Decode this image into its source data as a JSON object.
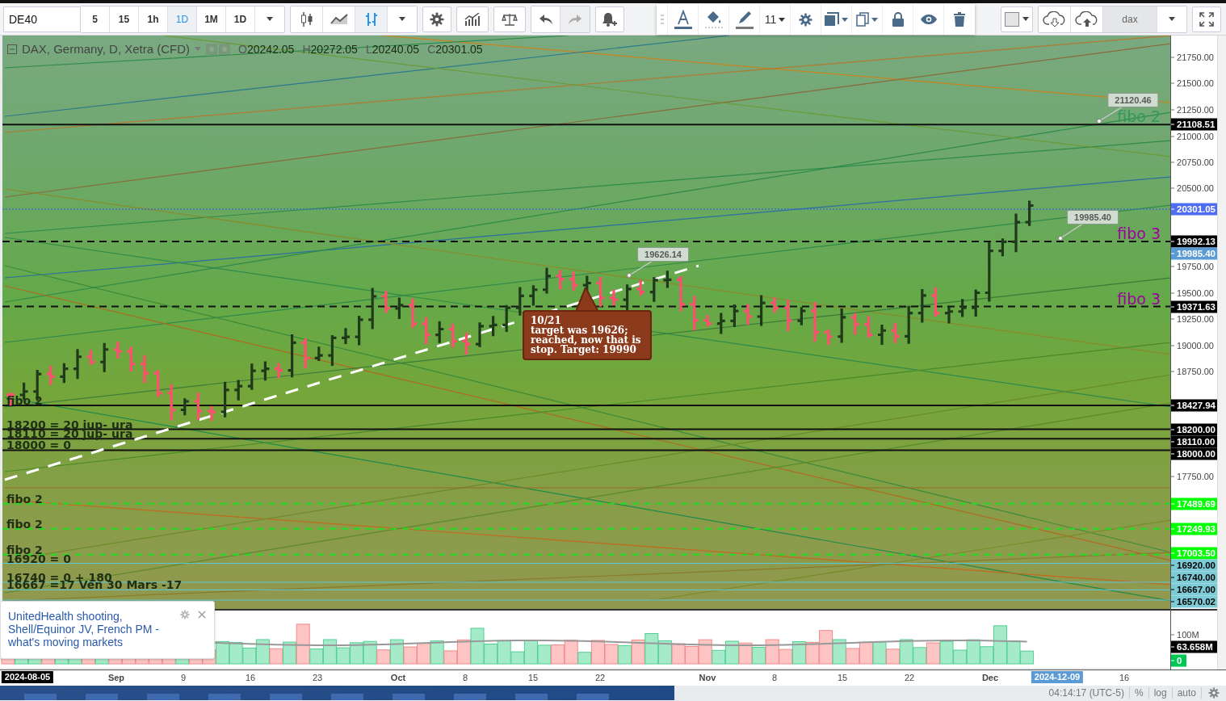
{
  "toolbar": {
    "symbol": "DE40",
    "intervals": [
      {
        "label": "5",
        "selected": false
      },
      {
        "label": "15",
        "selected": false
      },
      {
        "label": "1h",
        "selected": false
      },
      {
        "label": "1D",
        "selected": true
      },
      {
        "label": "1M",
        "selected": false
      },
      {
        "label": "1D",
        "selected": false
      }
    ],
    "chart_types": [
      {
        "kind": "candles",
        "selected": false
      },
      {
        "kind": "area",
        "selected": false
      },
      {
        "kind": "bars",
        "selected": true
      }
    ],
    "history": [
      {
        "kind": "undo",
        "disabled": false
      },
      {
        "kind": "redo",
        "disabled": true
      }
    ]
  },
  "drawing_toolbar": {
    "font_size": "11"
  },
  "layout_select": {
    "value": "dax"
  },
  "legend": {
    "title": "DAX, Germany, D, Xetra (CFD)",
    "values": [
      {
        "label": "O",
        "value": "20242.05"
      },
      {
        "label": "H",
        "value": "20272.05"
      },
      {
        "label": "L",
        "value": "20240.05"
      },
      {
        "label": "C",
        "value": "20301.05"
      }
    ]
  },
  "price_axis": [
    {
      "text": "21750.00"
    },
    {
      "text": "21500.00"
    },
    {
      "text": "21250.00"
    },
    {
      "text": "21108.51",
      "color": "#000000",
      "kind": "solid",
      "label_right": {
        "text": "fibo 2",
        "color": "#2e9a5e"
      }
    },
    {
      "text": "21000.00"
    },
    {
      "text": "20750.00"
    },
    {
      "text": "20500.00"
    },
    {
      "text": "20301.05",
      "color": "#4f6df0",
      "kind": "dotted"
    },
    {
      "text": "19992.13",
      "color": "#000000",
      "kind": "dashed",
      "label_right": {
        "text": "fibo 3",
        "color": "#a000a0"
      }
    },
    {
      "text": "19985.40",
      "color": "#5b9bd5"
    },
    {
      "text": "19750.00"
    },
    {
      "text": "19500.00"
    },
    {
      "text": "19371.63",
      "color": "#000000",
      "kind": "dashed",
      "label_right": {
        "text": "fibo 3",
        "color": "#a000a0"
      }
    },
    {
      "text": "19250.00"
    },
    {
      "text": "19000.00"
    },
    {
      "text": "18750.00"
    },
    {
      "text": "18427.94",
      "color": "#000000",
      "kind": "solid",
      "label_left": {
        "text": "fibo 2"
      }
    },
    {
      "text": "18200.00",
      "color": "#000000",
      "kind": "solid",
      "label_left": {
        "text": "18200 = 20 jup- ura"
      }
    },
    {
      "text": "18110.00",
      "color": "#000000",
      "kind": "solid",
      "label_left": {
        "text": "18110 = 20 jup- ura"
      }
    },
    {
      "text": "18000.00",
      "color": "#000000",
      "kind": "solid",
      "label_left": {
        "text": "18000 = 0"
      }
    },
    {
      "text": "17750.00"
    },
    {
      "text": "17489.69",
      "color": "#00ff00",
      "kind": "fib",
      "label_left": {
        "text": "fibo 2"
      }
    },
    {
      "text": "17249.93",
      "color": "#00ff00",
      "kind": "fib",
      "label_left": {
        "text": "fibo 2"
      }
    },
    {
      "text": "17003.50",
      "color": "#00ff00",
      "kind": "fib",
      "label_left": {
        "text": "fibo 2"
      }
    },
    {
      "text": "16920.00",
      "color": "#7ecbd8",
      "kind": "thin",
      "label_left": {
        "text": "16920 = 0"
      }
    },
    {
      "text": "16740.00",
      "color": "#7ecbd8",
      "kind": "thin",
      "label_left": {
        "text": "16740 = 0 + 180"
      }
    },
    {
      "text": "16667.00",
      "color": "#7ecbd8",
      "kind": "thin",
      "label_left": {
        "text": "16667  =17 Ven 30 Mars -17"
      }
    },
    {
      "text": "16570.02",
      "color": "#7ecbd8",
      "kind": "thin"
    }
  ],
  "volume_axis": [
    {
      "text": "100M"
    },
    {
      "text": "63.658M",
      "color": "#000000"
    },
    {
      "text": "0",
      "color": "#00c853"
    }
  ],
  "price_callouts": [
    {
      "text": "19626.14"
    },
    {
      "text": "21120.46"
    },
    {
      "text": "19985.40"
    }
  ],
  "note": {
    "text": "10/21\n target was 19626;\n reached, now that is\nstop. Target: 19990"
  },
  "news": {
    "headline": "UnitedHealth shooting, Shell/Equinor JV, French PM - what's moving markets"
  },
  "time_axis": [
    {
      "text": "2024-08-05",
      "kind": "cursor"
    },
    {
      "text": "Sep",
      "kind": "month"
    },
    {
      "text": "9",
      "kind": "day"
    },
    {
      "text": "16",
      "kind": "day"
    },
    {
      "text": "23",
      "kind": "day"
    },
    {
      "text": "Oct",
      "kind": "month"
    },
    {
      "text": "8",
      "kind": "day"
    },
    {
      "text": "15",
      "kind": "day"
    },
    {
      "text": "22",
      "kind": "day"
    },
    {
      "text": "Nov",
      "kind": "month"
    },
    {
      "text": "8",
      "kind": "day"
    },
    {
      "text": "15",
      "kind": "day"
    },
    {
      "text": "22",
      "kind": "day"
    },
    {
      "text": "Dec",
      "kind": "month"
    },
    {
      "text": "2024-12-09",
      "kind": "hover"
    },
    {
      "text": "16",
      "kind": "day"
    }
  ],
  "status_bar": {
    "time": "04:14:17",
    "timezone": "(UTC-5)",
    "toggles": [
      "%",
      "log",
      "auto"
    ]
  }
}
